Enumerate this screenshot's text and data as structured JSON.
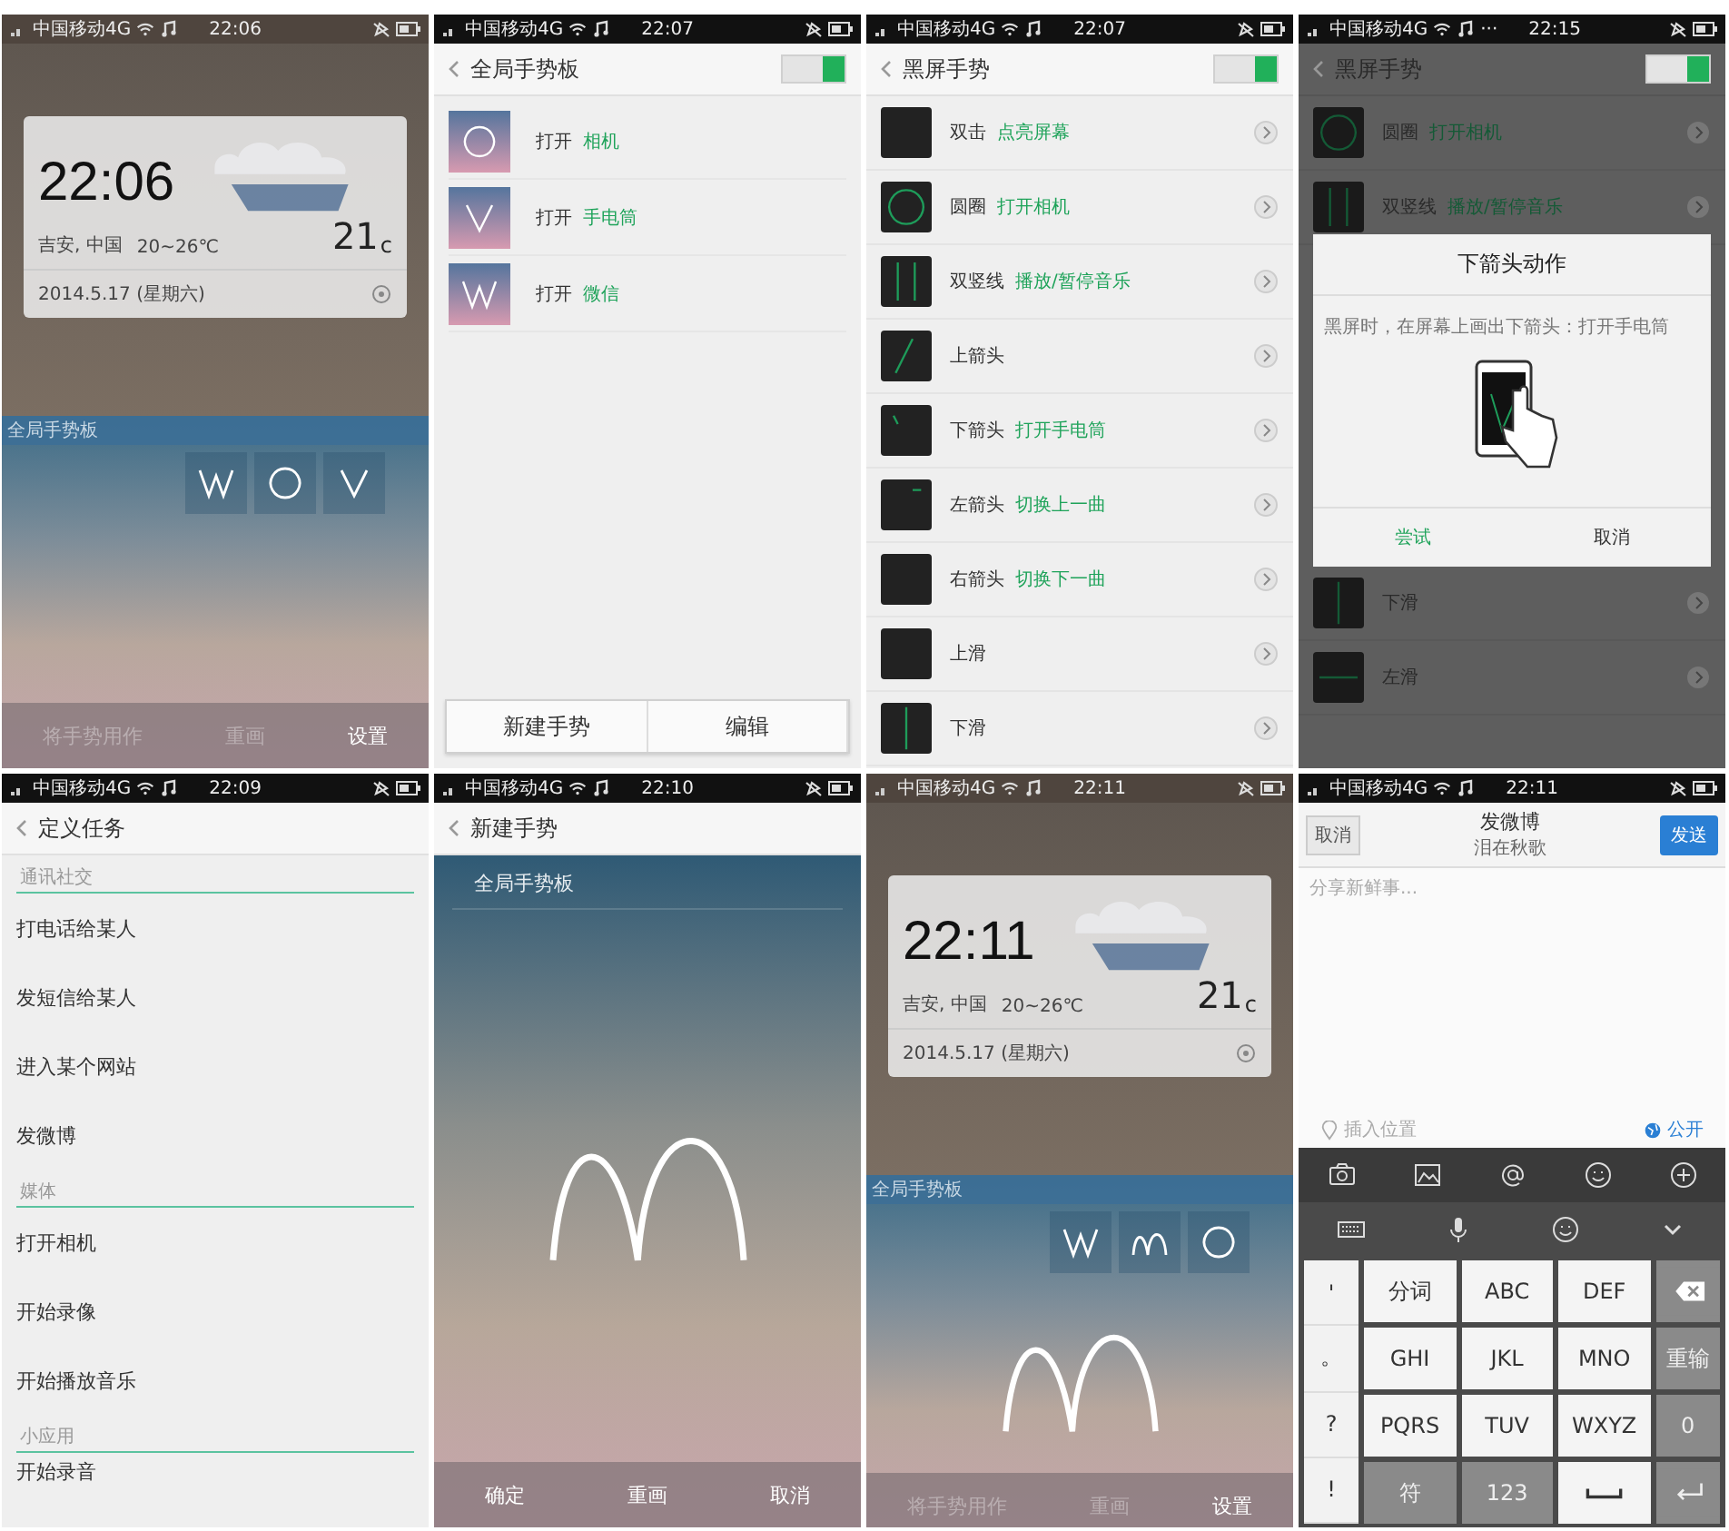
{
  "panels": [
    {
      "kind": "lock",
      "status": {
        "carrier": "中国移动4G",
        "time": "22:06"
      },
      "clock": "22:06",
      "location": "吉安, 中国",
      "range": "20~26℃",
      "temp": "21",
      "unit": "c",
      "date": "2014.5.17 (星期六)",
      "board_label": "全局手势板",
      "gestures": [
        {
          "kind": "w"
        },
        {
          "kind": "circle"
        },
        {
          "kind": "v"
        }
      ],
      "bottom": [
        {
          "label": "将手势用作",
          "disabled": true
        },
        {
          "label": "重画",
          "disabled": true
        },
        {
          "label": "设置",
          "disabled": false
        }
      ]
    },
    {
      "kind": "board",
      "status": {
        "carrier": "中国移动4G",
        "time": "22:07"
      },
      "header": {
        "title": "全局手势板",
        "toggle_on": true
      },
      "items": [
        {
          "kind": "circle",
          "verb": "打开",
          "target": "相机"
        },
        {
          "kind": "v",
          "verb": "打开",
          "target": "手电筒"
        },
        {
          "kind": "w",
          "verb": "打开",
          "target": "微信"
        }
      ],
      "buttons": [
        "新建手势",
        "编辑"
      ]
    },
    {
      "kind": "black",
      "status": {
        "carrier": "中国移动4G",
        "time": "22:07"
      },
      "header": {
        "title": "黑屏手势",
        "toggle_on": true
      },
      "rows": [
        {
          "kind": "tap",
          "name": "双击",
          "action": "点亮屏幕"
        },
        {
          "kind": "circle",
          "name": "圆圈",
          "action": "打开相机"
        },
        {
          "kind": "double_line",
          "name": "双竖线",
          "action": "播放/暂停音乐"
        },
        {
          "kind": "up_arrow",
          "name": "上箭头"
        },
        {
          "kind": "down_arrow",
          "name": "下箭头",
          "action": "打开手电筒"
        },
        {
          "kind": "left_arrow",
          "name": "左箭头",
          "action": "切换上一曲"
        },
        {
          "kind": "right_arrow",
          "name": "右箭头",
          "action": "切换下一曲"
        },
        {
          "kind": "swipe_up",
          "name": "上滑"
        },
        {
          "kind": "swipe_down",
          "name": "下滑"
        }
      ]
    },
    {
      "kind": "dialog",
      "status": {
        "carrier": "中国移动4G",
        "extra": "···",
        "time": "22:15"
      },
      "header": {
        "title": "黑屏手势",
        "toggle_on": true
      },
      "rows_above": [
        {
          "kind": "circle",
          "name": "圆圈",
          "action": "打开相机"
        },
        {
          "kind": "double_line",
          "name": "双竖线",
          "action": "播放/暂停音乐"
        }
      ],
      "dialog": {
        "title": "下箭头动作",
        "message": "黑屏时，在屏幕上画出下箭头：打开手电筒",
        "confirm": "尝试",
        "cancel": "取消"
      },
      "rows_below": [
        {
          "kind": "swipe_down",
          "name": "下滑"
        },
        {
          "kind": "swipe_left",
          "name": "左滑"
        }
      ]
    },
    {
      "kind": "tasks",
      "status": {
        "carrier": "中国移动4G",
        "time": "22:09"
      },
      "header": {
        "title": "定义任务"
      },
      "sections": [
        {
          "title": "通讯社交",
          "items": [
            "打电话给某人",
            "发短信给某人",
            "进入某个网站",
            "发微博"
          ]
        },
        {
          "title": "媒体",
          "items": [
            "打开相机",
            "开始录像",
            "开始播放音乐"
          ]
        },
        {
          "title": "小应用",
          "items": [
            "开始录音"
          ]
        }
      ]
    },
    {
      "kind": "new",
      "status": {
        "carrier": "中国移动4G",
        "time": "22:10"
      },
      "header": {
        "title": "新建手势"
      },
      "board_label": "全局手势板",
      "stroke": {
        "kind": "m"
      },
      "actions": [
        "确定",
        "重画",
        "取消"
      ]
    },
    {
      "kind": "lock",
      "status": {
        "carrier": "中国移动4G",
        "time": "22:11"
      },
      "clock": "22:11",
      "location": "吉安, 中国",
      "range": "20~26℃",
      "temp": "21",
      "unit": "c",
      "date": "2014.5.17 (星期六)",
      "board_label": "全局手势板",
      "gestures": [
        {
          "kind": "w"
        },
        {
          "kind": "m"
        },
        {
          "kind": "circle"
        }
      ],
      "stroke": {
        "kind": "m"
      },
      "bottom": [
        {
          "label": "将手势用作",
          "disabled": true
        },
        {
          "label": "重画",
          "disabled": true
        },
        {
          "label": "设置",
          "disabled": false
        }
      ]
    },
    {
      "kind": "weibo",
      "status": {
        "carrier": "中国移动4G",
        "time": "22:11"
      },
      "cancel": "取消",
      "title": "发微博",
      "subtitle": "泪在秋歌",
      "send": "发送",
      "placeholder": "分享新鲜事...",
      "location": "插入位置",
      "visibility": "公开",
      "toolbar": [
        {
          "kind": "camera"
        },
        {
          "kind": "image"
        },
        {
          "kind": "at"
        },
        {
          "kind": "emoji"
        },
        {
          "kind": "plus"
        }
      ],
      "side_keys": [
        "'",
        "。",
        "?",
        "!"
      ],
      "keys": [
        {
          "kind": "char",
          "label": "分词"
        },
        {
          "kind": "char",
          "label": "ABC"
        },
        {
          "kind": "char",
          "label": "DEF"
        },
        {
          "kind": "backspace"
        },
        {
          "kind": "char",
          "label": "GHI"
        },
        {
          "kind": "char",
          "label": "JKL"
        },
        {
          "kind": "char",
          "label": "MNO"
        },
        {
          "kind": "func",
          "label": "重输"
        },
        {
          "kind": "char",
          "label": "PQRS"
        },
        {
          "kind": "char",
          "label": "TUV"
        },
        {
          "kind": "char",
          "label": "WXYZ"
        },
        {
          "kind": "func",
          "label": "0"
        },
        {
          "kind": "func",
          "label": "符"
        },
        {
          "kind": "func",
          "label": "123"
        },
        {
          "kind": "space"
        },
        {
          "kind": "enter"
        }
      ]
    }
  ]
}
